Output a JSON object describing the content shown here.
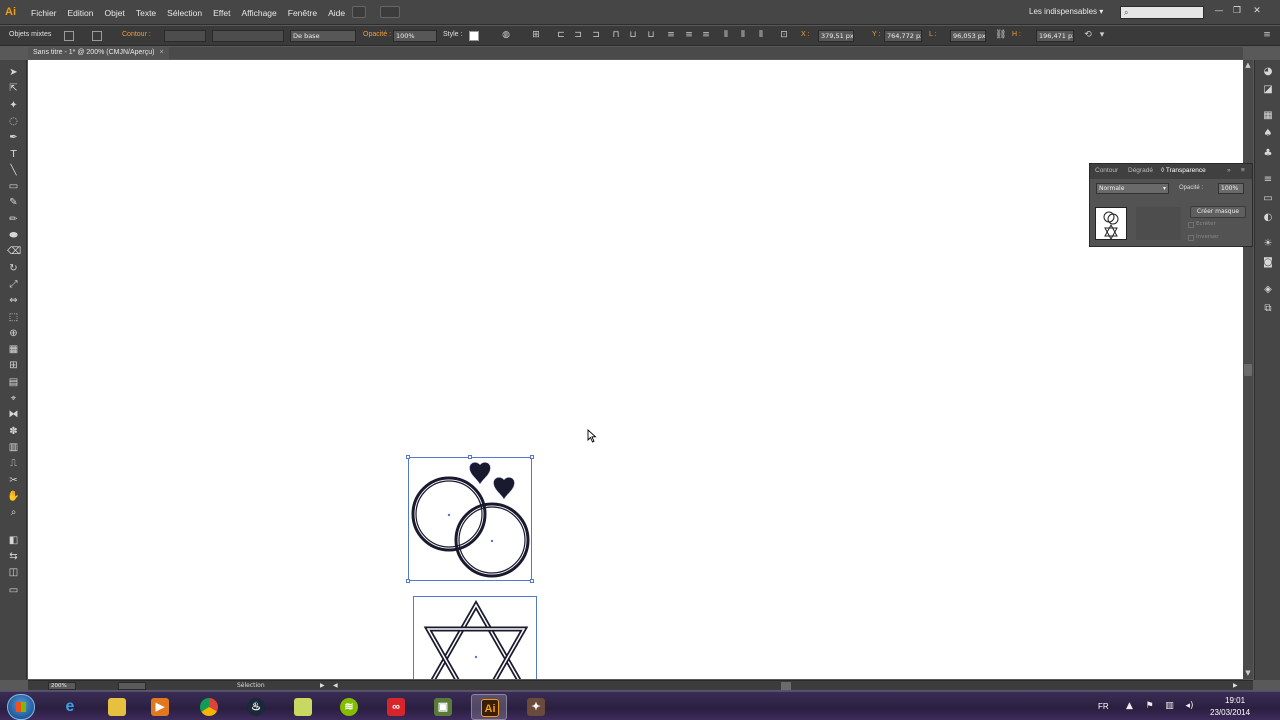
{
  "app": {
    "logo": "Ai"
  },
  "menu": [
    "Fichier",
    "Edition",
    "Objet",
    "Texte",
    "Sélection",
    "Effet",
    "Affichage",
    "Fenêtre",
    "Aide"
  ],
  "workspace": "Les indispensables ▾",
  "control": {
    "mixed_objects": "Objets mixtes",
    "stroke_label": "Contour :",
    "stroke_profile": "De base",
    "opacity_label": "Opacité :",
    "opacity_value": "100%",
    "style_label": "Style :",
    "x_label": "X :",
    "x_value": "379,51 px",
    "y_label": "Y :",
    "y_value": "764,772 px",
    "w_label": "L :",
    "w_value": "96,053 px",
    "h_label": "H :",
    "h_value": "196,471 px"
  },
  "document": {
    "tab_title": "Sans titre - 1* @ 200% (CMJN/Aperçu)",
    "close": "×"
  },
  "panel": {
    "tabs": [
      "Contour",
      "Dégradé",
      "◊ Transparence"
    ],
    "blend_mode": "Normale",
    "opacity_label": "Opacité :",
    "opacity_value": "100%",
    "create_mask": "Créer masque",
    "clip": "Ecrêter",
    "invert": "Inverser"
  },
  "status": {
    "zoom": "200%",
    "tool": "Sélection"
  },
  "taskbar": {
    "lang": "FR",
    "time": "19:01",
    "date": "23/03/2014"
  },
  "icons": {
    "tools": [
      "selection-tool-icon",
      "direct-selection-tool-icon",
      "magic-wand-icon",
      "lasso-icon",
      "pen-icon",
      "type-icon",
      "line-icon",
      "rectangle-icon",
      "brush-icon",
      "pencil-icon",
      "blob-brush-icon",
      "eraser-icon",
      "rotate-icon",
      "scale-icon",
      "width-icon",
      "free-transform-icon",
      "shape-builder-icon",
      "perspective-icon",
      "mesh-icon",
      "gradient-icon",
      "eyedropper-icon",
      "blend-icon",
      "symbol-sprayer-icon",
      "graph-icon",
      "artboard-icon",
      "slice-icon",
      "hand-icon",
      "zoom-icon"
    ]
  }
}
